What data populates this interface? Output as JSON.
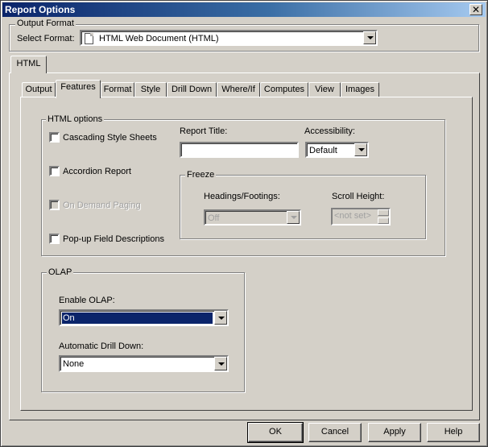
{
  "window": {
    "title": "Report Options",
    "close_glyph": "✕"
  },
  "output_format": {
    "group_label": "Output Format",
    "select_label": "Select Format:",
    "selected": "HTML Web Document (HTML)",
    "icon": "document-icon"
  },
  "outer_tabs": [
    {
      "label": "HTML",
      "active": true
    }
  ],
  "inner_tabs": [
    {
      "label": "Output",
      "active": false
    },
    {
      "label": "Features",
      "active": true
    },
    {
      "label": "Format",
      "active": false
    },
    {
      "label": "Style",
      "active": false
    },
    {
      "label": "Drill Down",
      "active": false
    },
    {
      "label": "Where/If",
      "active": false
    },
    {
      "label": "Computes",
      "active": false
    },
    {
      "label": "View",
      "active": false
    },
    {
      "label": "Images",
      "active": false
    }
  ],
  "html_options": {
    "group_label": "HTML options",
    "checkboxes": [
      {
        "label": "Cascading Style Sheets",
        "checked": false,
        "enabled": true
      },
      {
        "label": "Accordion Report",
        "checked": false,
        "enabled": true
      },
      {
        "label": "On Demand Paging",
        "checked": false,
        "enabled": false
      },
      {
        "label": "Pop-up Field Descriptions",
        "checked": false,
        "enabled": true
      }
    ],
    "report_title_label": "Report Title:",
    "report_title_value": "",
    "accessibility_label": "Accessibility:",
    "accessibility_value": "Default",
    "freeze": {
      "group_label": "Freeze",
      "headings_label": "Headings/Footings:",
      "headings_value": "Off",
      "scroll_label": "Scroll Height:",
      "scroll_value": "<not set>"
    }
  },
  "olap": {
    "group_label": "OLAP",
    "enable_label": "Enable OLAP:",
    "enable_value": "On",
    "drill_label": "Automatic Drill Down:",
    "drill_value": "None"
  },
  "buttons": {
    "ok": "OK",
    "cancel": "Cancel",
    "apply": "Apply",
    "help": "Help"
  },
  "colors": {
    "face": "#d4d0c8",
    "title_start": "#0a246a",
    "title_end": "#a6caf0",
    "highlight": "#0a246a"
  }
}
